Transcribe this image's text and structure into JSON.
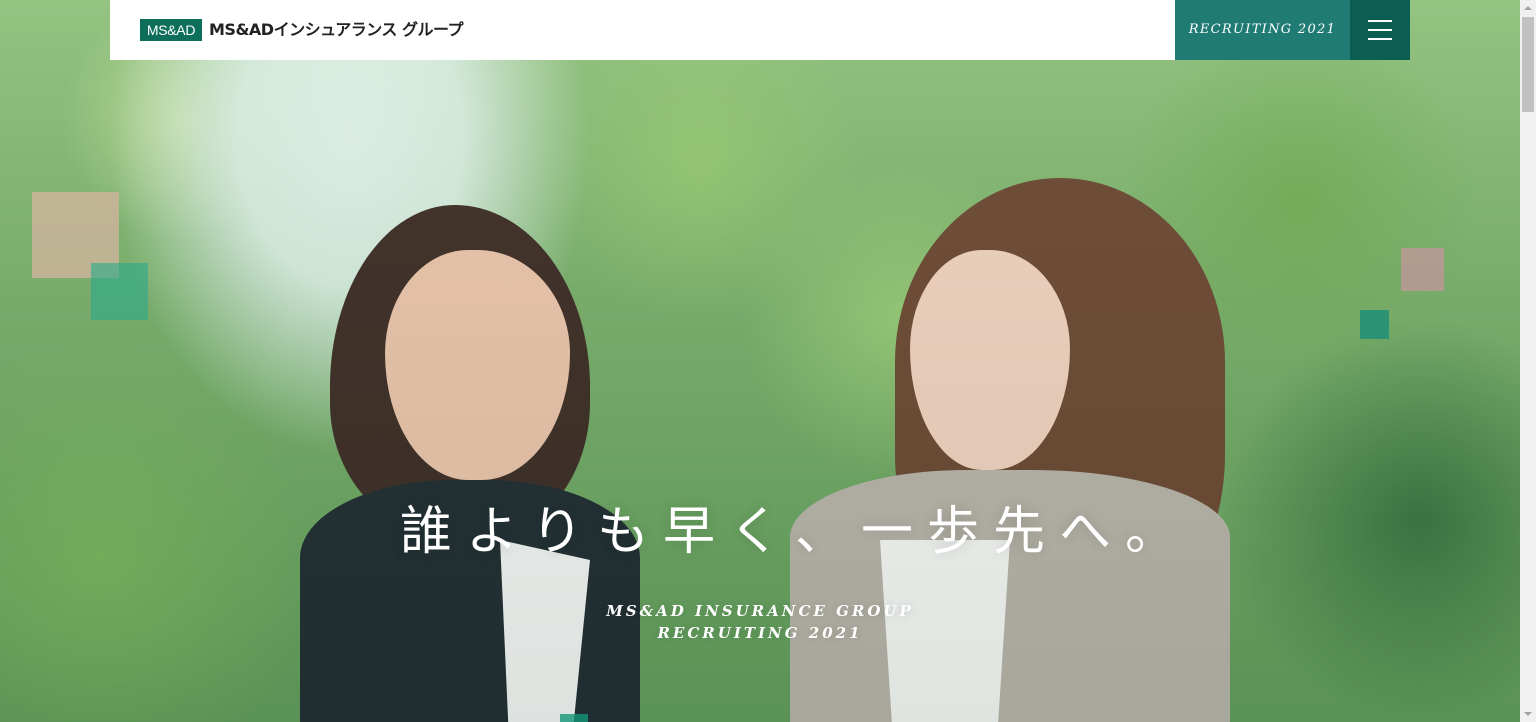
{
  "header": {
    "logo_mark": "MS&AD",
    "logo_text": "MS&ADインシュアランス グループ",
    "recruiting_label": "RECRUITING 2021",
    "menu_icon": "hamburger-icon"
  },
  "hero": {
    "catchphrase": "誰よりも早く、一歩先へ。",
    "subtitle_line1": "MS&AD INSURANCE GROUP",
    "subtitle_line2": "RECRUITING 2021"
  },
  "colors": {
    "brand_green": "#0d6e5a",
    "recruit_teal": "#1f7b74",
    "menu_dark_teal": "#0c5e52"
  }
}
